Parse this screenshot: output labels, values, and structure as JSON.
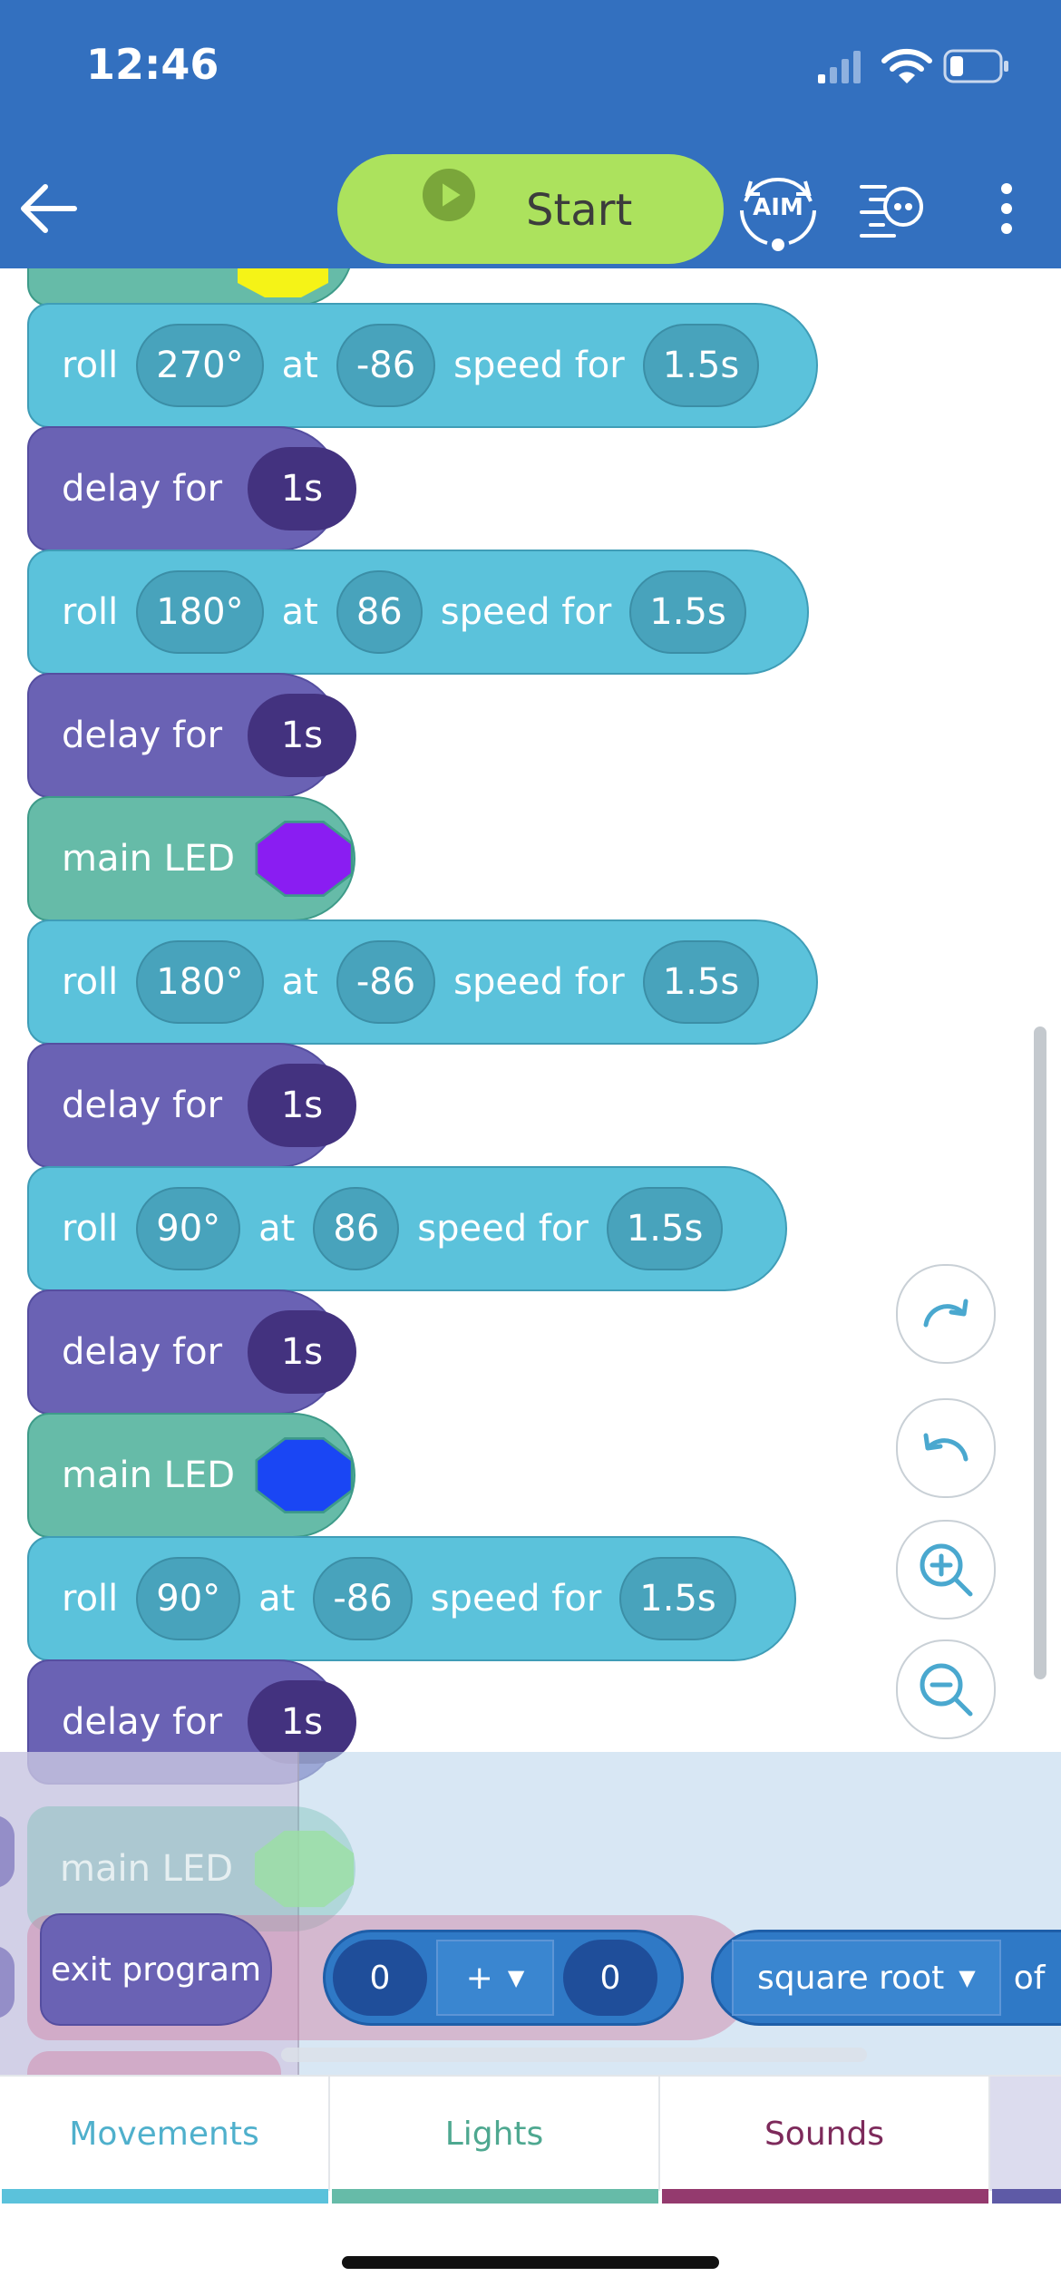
{
  "status_bar": {
    "time": "12:46"
  },
  "toolbar": {
    "start_label": "Start",
    "aim_label": "AIM"
  },
  "program": {
    "roll_word": "roll",
    "at_word": "at",
    "speed_for_word": "speed for",
    "delay_word": "delay for",
    "led_word": "main LED",
    "blocks": [
      {
        "type": "roll",
        "heading": "270°",
        "speed": "-86",
        "duration": "1.5s"
      },
      {
        "type": "delay",
        "duration": "1s"
      },
      {
        "type": "roll",
        "heading": "180°",
        "speed": "86",
        "duration": "1.5s"
      },
      {
        "type": "delay",
        "duration": "1s"
      },
      {
        "type": "led",
        "color": "#8a1df2"
      },
      {
        "type": "roll",
        "heading": "180°",
        "speed": "-86",
        "duration": "1.5s"
      },
      {
        "type": "delay",
        "duration": "1s"
      },
      {
        "type": "roll",
        "heading": "90°",
        "speed": "86",
        "duration": "1.5s"
      },
      {
        "type": "delay",
        "duration": "1s"
      },
      {
        "type": "led",
        "color": "#1a46f4"
      },
      {
        "type": "roll",
        "heading": "90°",
        "speed": "-86",
        "duration": "1.5s"
      },
      {
        "type": "delay",
        "duration": "1s"
      }
    ]
  },
  "drawer": {
    "faded_led_label": "main LED",
    "faded_led_color": "#9be0a3",
    "exit_label": "exit program",
    "math_left": "0",
    "math_op": "+",
    "math_right": "0",
    "function_label": "square root",
    "of_label": "of"
  },
  "categories": [
    {
      "label": "Movements",
      "color": "#5bc2db",
      "text_color": "#4fb0cc"
    },
    {
      "label": "Lights",
      "color": "#66bba8",
      "text_color": "#4ea890"
    },
    {
      "label": "Sounds",
      "color": "#943a6e",
      "text_color": "#7d2a5b"
    }
  ]
}
